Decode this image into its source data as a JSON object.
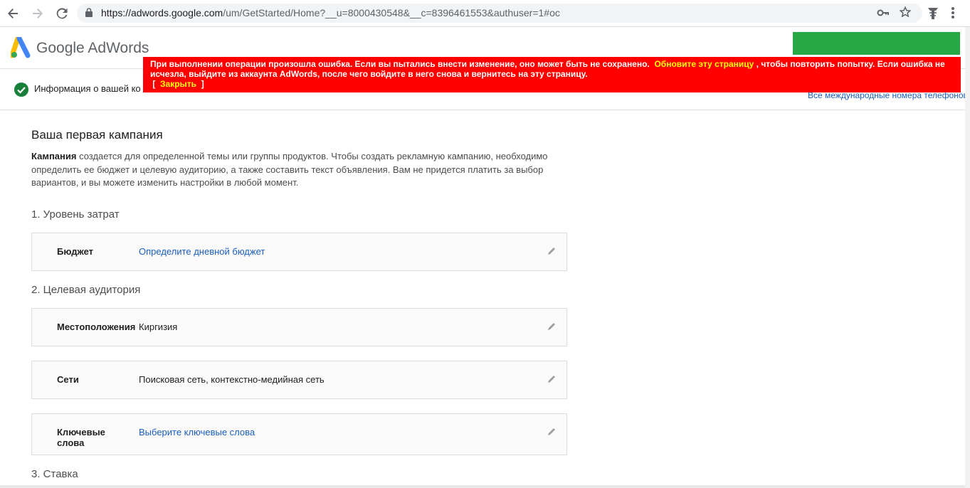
{
  "browser": {
    "url_host": "https://adwords.google.com",
    "url_rest": "/um/GetStarted/Home?__u=8000430548&__c=8396461553&authuser=1#oc",
    "icons": [
      "back-icon",
      "forward-icon",
      "reload-icon",
      "lock-icon",
      "key-icon",
      "star-icon",
      "extension-icon",
      "menu-icon"
    ]
  },
  "header": {
    "logo_text": "Google AdWords"
  },
  "steps": {
    "step1": "Информация о вашей ко",
    "intl_link": "Все международные номера телефонов"
  },
  "error": {
    "part1": "При выполнении операции произошла ошибка. Если вы пытались внести изменение, оно может быть не сохранено.",
    "refresh_link": "Обновите эту страницу",
    "part2": ", чтобы повторить попытку. Если ошибка не исчезла, выйдите из аккаунта AdWords, после чего войдите в него снова и вернитесь на эту страницу.",
    "bracket_open": "[",
    "close_link": "Закрыть",
    "bracket_close": "]"
  },
  "main": {
    "title": "Ваша первая кампания",
    "intro_bold": "Кампания",
    "intro_text": " создается для определенной темы или группы продуктов. Чтобы создать рекламную кампанию, необходимо определить ее бюджет и целевую аудиторию, а также составить текст объявления. Вам не придется платить за выбор вариантов, и вы можете изменить настройки в любой момент.",
    "section1": "1. Уровень затрат",
    "budget_label": "Бюджет",
    "budget_value": "Определите дневной бюджет",
    "section2": "2. Целевая аудитория",
    "locations_label": "Местоположения",
    "locations_value": "Киргизия",
    "networks_label": "Сети",
    "networks_value": "Поисковая сеть, контекстно-медийная сеть",
    "keywords_label": "Ключевые слова",
    "keywords_value": "Выберите ключевые слова",
    "section3": "3. Ставка"
  },
  "colors": {
    "error_bg": "#ff0000",
    "error_link": "#ffff00",
    "link": "#1a5ebd",
    "green_bar": "#28a745"
  }
}
